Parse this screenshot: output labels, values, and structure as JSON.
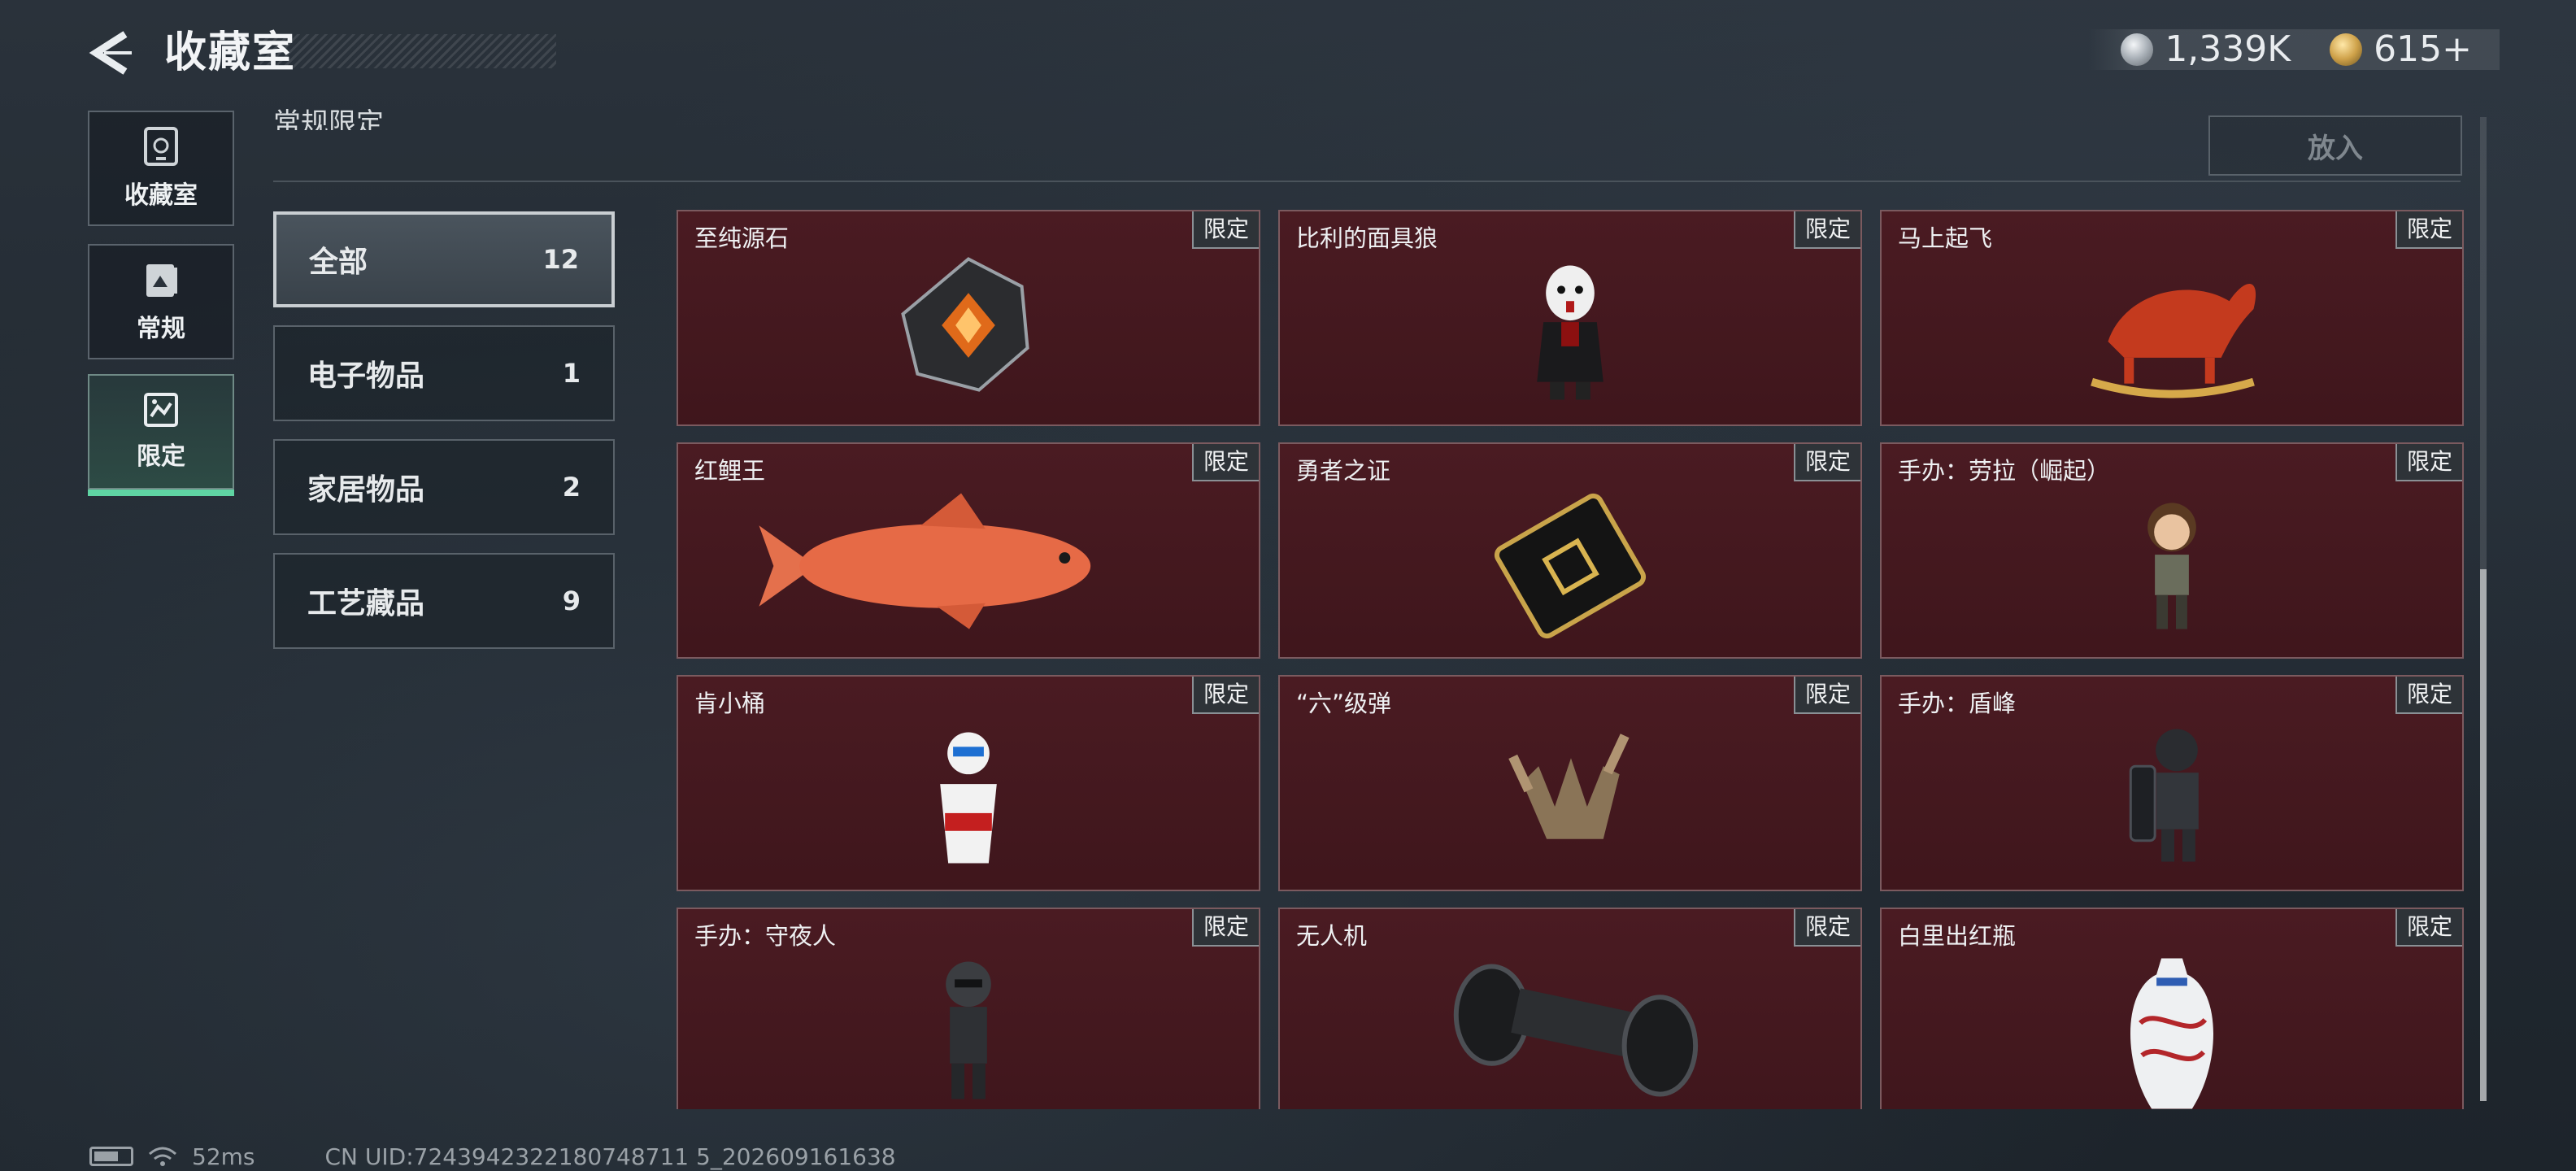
{
  "header": {
    "title": "收藏室",
    "currencies": [
      {
        "icon": "silver-coin-icon",
        "value": "1,339K"
      },
      {
        "icon": "gold-coin-icon",
        "value": "615+"
      }
    ]
  },
  "sidenav": {
    "items": [
      {
        "label": "收藏室",
        "icon": "collection-icon",
        "active": false
      },
      {
        "label": "常规",
        "icon": "album-icon",
        "active": false
      },
      {
        "label": "限定",
        "icon": "limited-icon",
        "active": true
      }
    ]
  },
  "section": {
    "title": "常规限定",
    "put_in_label": "放入"
  },
  "categories": [
    {
      "name": "全部",
      "count": "12",
      "active": true
    },
    {
      "name": "电子物品",
      "count": "1",
      "active": false
    },
    {
      "name": "家居物品",
      "count": "2",
      "active": false
    },
    {
      "name": "工艺藏品",
      "count": "9",
      "active": false
    }
  ],
  "items": [
    {
      "name": "至纯源石",
      "tag": "限定",
      "icon": "gem-icon"
    },
    {
      "name": "比利的面具狼",
      "tag": "限定",
      "icon": "puppet-figure-icon"
    },
    {
      "name": "马上起飞",
      "tag": "限定",
      "icon": "rocking-horse-icon"
    },
    {
      "name": "红鲤王",
      "tag": "限定",
      "icon": "fish-icon"
    },
    {
      "name": "勇者之证",
      "tag": "限定",
      "icon": "card-icon"
    },
    {
      "name": "手办：劳拉（崛起）",
      "tag": "限定",
      "icon": "figure-icon"
    },
    {
      "name": "肯小桶",
      "tag": "限定",
      "icon": "bucket-figure-icon"
    },
    {
      "name": "“六”级弹",
      "tag": "限定",
      "icon": "hand-bullets-icon"
    },
    {
      "name": "手办：盾峰",
      "tag": "限定",
      "icon": "shield-figure-icon"
    },
    {
      "name": "手办：守夜人",
      "tag": "限定",
      "icon": "figure-icon"
    },
    {
      "name": "无人机",
      "tag": "限定",
      "icon": "drone-icon"
    },
    {
      "name": "白里出红瓶",
      "tag": "限定",
      "icon": "vase-icon"
    }
  ],
  "status": {
    "ping": "52ms",
    "uid": "CN UID:7243942322180748711 5_202609161638"
  },
  "colors": {
    "accent": "#5fd4a3",
    "card_bg": "#45191f",
    "card_border": "#7b5a5f"
  }
}
